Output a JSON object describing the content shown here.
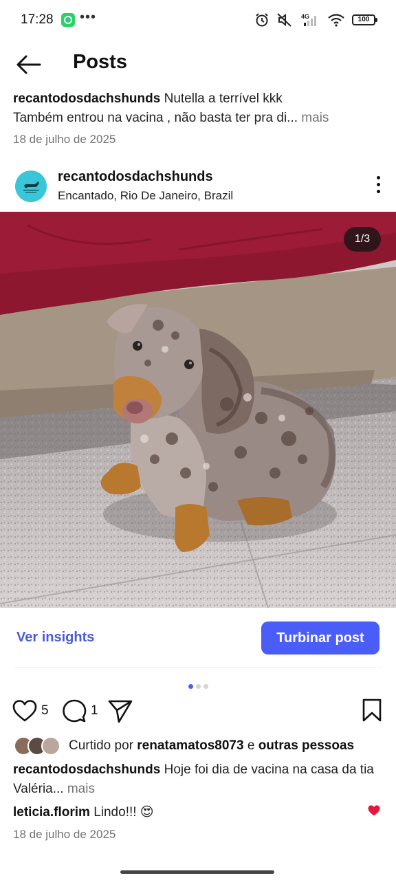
{
  "status_bar": {
    "time": "17:28",
    "more": "•••",
    "icons": [
      "whatsapp-icon",
      "alarm-icon",
      "mute-icon",
      "signal-4g-icon",
      "wifi-icon",
      "battery-icon"
    ],
    "network": "4G",
    "battery": "100"
  },
  "header": {
    "title": "Posts",
    "back_icon": "arrow-left-icon"
  },
  "previous_post": {
    "username": "recantodosdachshunds",
    "caption_line1": "Nutella a terrível kkk",
    "caption_line2": "Também entrou na vacina , não basta ter pra di...",
    "more": "mais",
    "date": "18 de julho de 2025"
  },
  "post": {
    "username": "recantodosdachshunds",
    "location": "Encantado, Rio De Janeiro, Brazil",
    "menu_icon": "more-vertical-icon",
    "media_counter": "1/3",
    "media_count": 3,
    "active_media": 1,
    "insights_label": "Ver insights",
    "boost_label": "Turbinar post",
    "likes_count": "5",
    "comments_count": "1",
    "liked_by_prefix": "Curtido por",
    "liked_by_user": "renatamatos8073",
    "liked_by_join": "e",
    "liked_by_rest": "outras pessoas",
    "caption_username": "recantodosdachshunds",
    "caption_text": "Hoje foi dia de vacina na casa da tia Valéria...",
    "caption_more": "mais",
    "comment_username": "leticia.florim",
    "comment_text": "Lindo!!! 😍",
    "date": "18 de julho de 2025"
  },
  "colors": {
    "accent": "#4a5df9",
    "link": "#4a5bd9",
    "muted": "#737373",
    "heart": "#e8173a"
  }
}
